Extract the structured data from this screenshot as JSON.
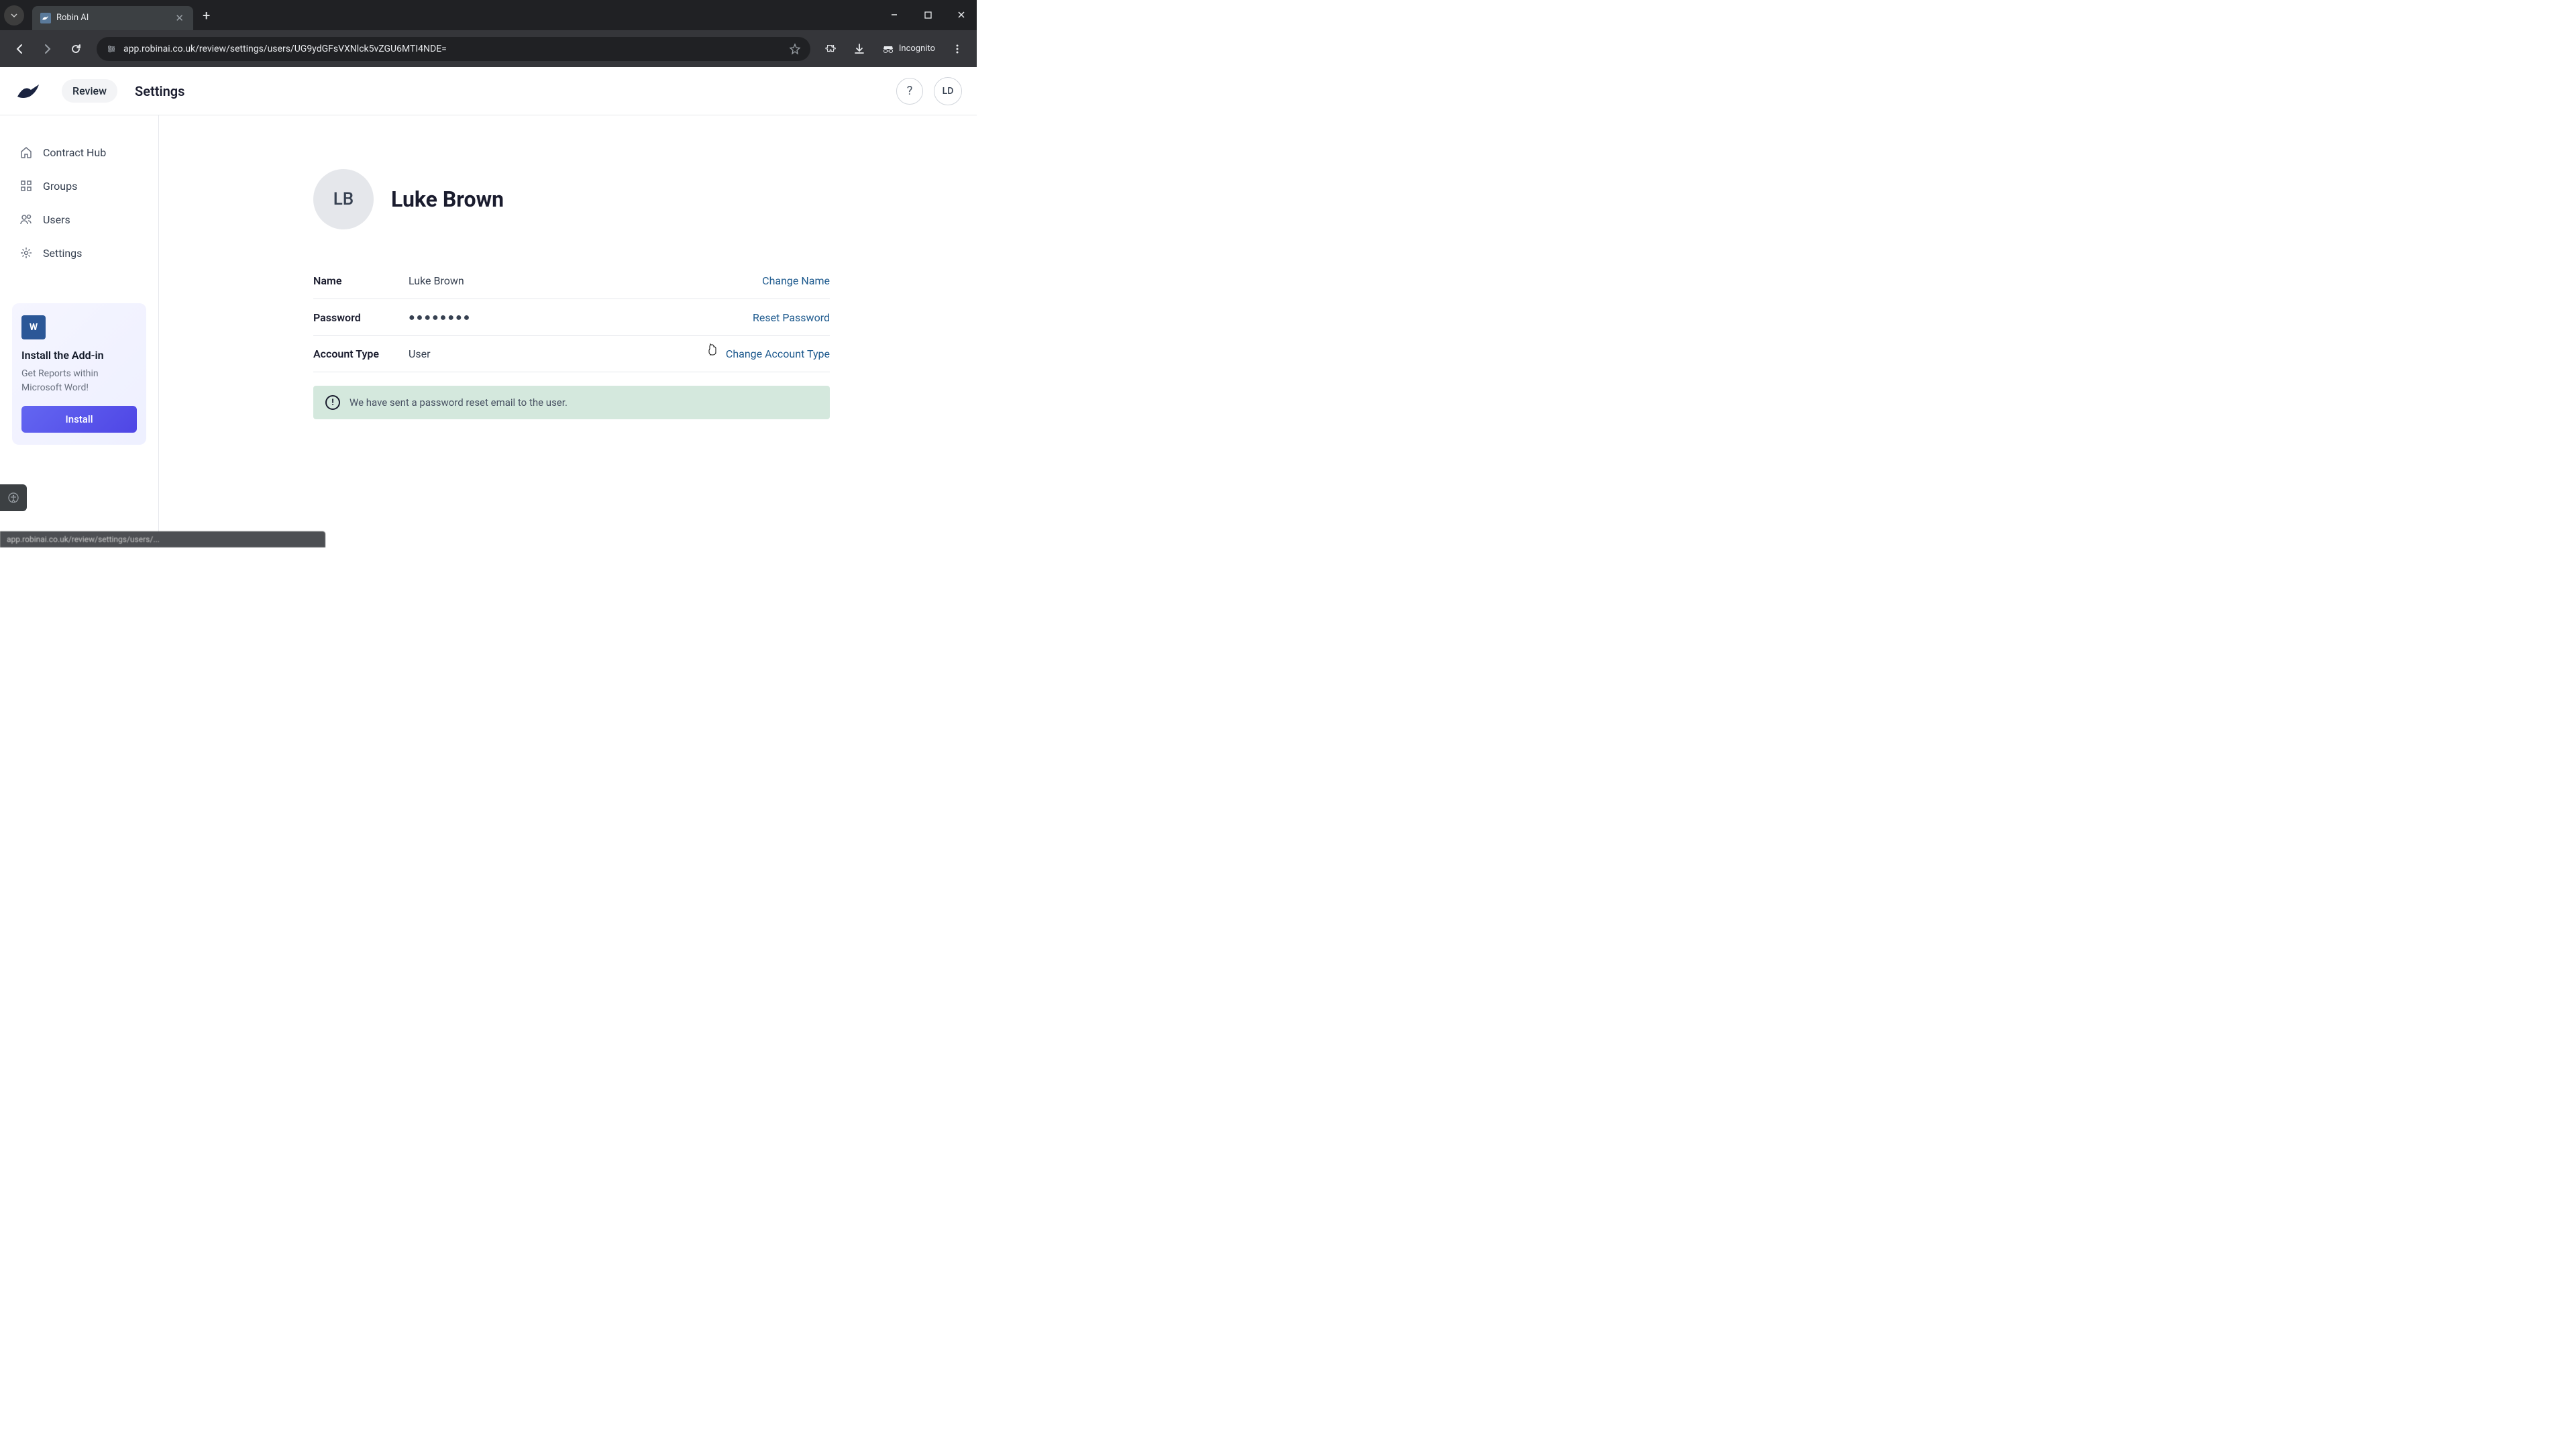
{
  "browser": {
    "tab_title": "Robin AI",
    "url": "app.robinai.co.uk/review/settings/users/UG9ydGFsVXNlck5vZGU6MTI4NDE=",
    "incognito_label": "Incognito"
  },
  "header": {
    "review_label": "Review",
    "page_title": "Settings",
    "user_initials": "LD"
  },
  "sidebar": {
    "items": [
      {
        "label": "Contract Hub"
      },
      {
        "label": "Groups"
      },
      {
        "label": "Users"
      },
      {
        "label": "Settings"
      }
    ],
    "addon": {
      "title": "Install the Add-in",
      "description": "Get Reports within Microsoft Word!",
      "button_label": "Install"
    }
  },
  "profile": {
    "initials": "LB",
    "full_name": "Luke Brown",
    "fields": {
      "name": {
        "label": "Name",
        "value": "Luke Brown",
        "action": "Change Name"
      },
      "password": {
        "label": "Password",
        "value": "●●●●●●●●",
        "action": "Reset Password"
      },
      "account_type": {
        "label": "Account Type",
        "value": "User",
        "action": "Change Account Type"
      }
    }
  },
  "notification": {
    "message": "We have sent a password reset email to the user."
  },
  "status_bar": {
    "text": "app.robinai.co.uk/review/settings/users/..."
  }
}
